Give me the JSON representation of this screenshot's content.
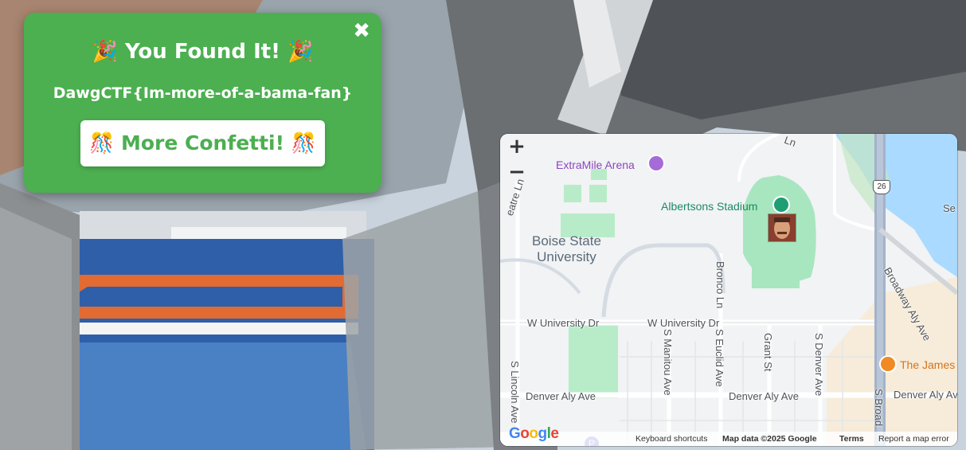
{
  "popup": {
    "close_icon": "✖",
    "title": "🎉 You Found It! 🎉",
    "flag": "DawgCTF{Im-more-of-a-bama-fan}",
    "confetti_button": "🎊 More Confetti! 🎊",
    "bg_color": "#4caf50"
  },
  "map": {
    "zoom_in": "+",
    "zoom_out": "−",
    "pois": {
      "arena": "ExtraMile Arena",
      "stadium": "Albertsons Stadium",
      "university": "Boise State\nUniversity",
      "restaurant": "The James",
      "east_edge": "Se"
    },
    "highway_shield": "26",
    "parking_icon": "P",
    "streets": {
      "w_university_1": "W University Dr",
      "w_university_2": "W University Dr",
      "denver_aly_1": "Denver Aly Ave",
      "denver_aly_2": "Denver Aly Ave",
      "denver_aly_3": "Denver Aly Ave",
      "broadway_aly": "Broadway Aly Ave",
      "s_lincoln": "S Lincoln Ave",
      "s_manitou": "S Manitou Ave",
      "s_euclid": "S Euclid Ave",
      "grant": "Grant St",
      "s_denver": "S Denver Ave",
      "s_broadway": "S Broad",
      "bronco": "Bronco Ln",
      "theatre": "eatre Ln",
      "top_ln": "Ln"
    },
    "footer": {
      "logo": "Google",
      "keyboard": "Keyboard shortcuts",
      "map_data": "Map data ©2025 Google",
      "terms": "Terms",
      "report": "Report a map error"
    }
  }
}
